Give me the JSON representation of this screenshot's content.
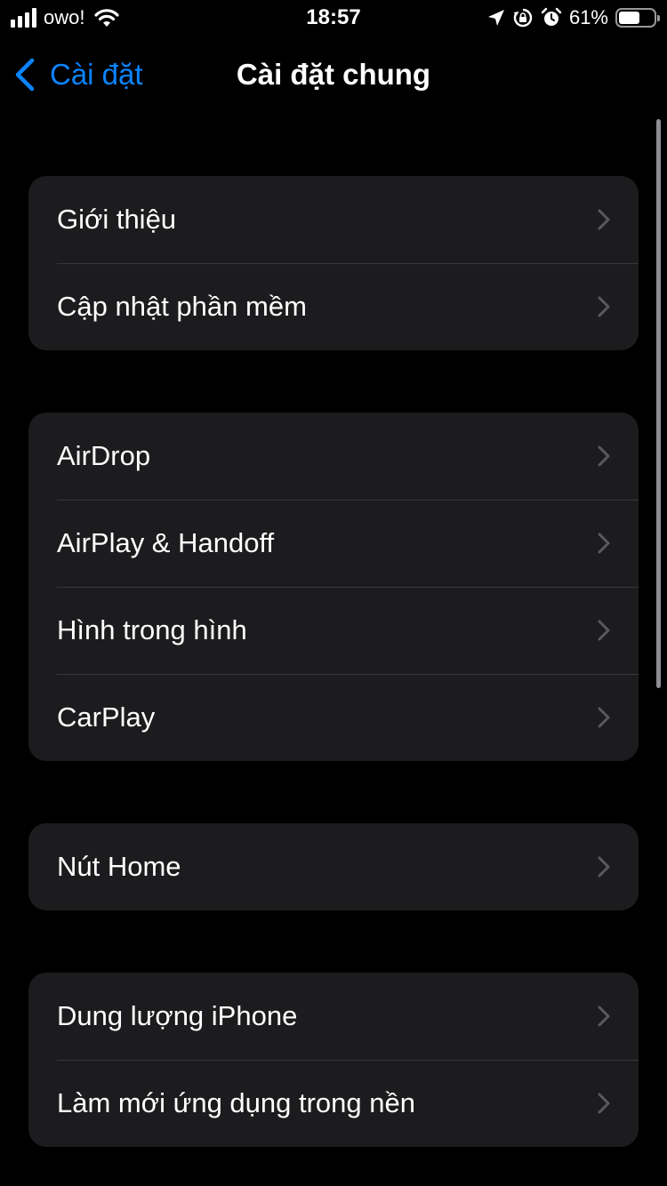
{
  "status_bar": {
    "carrier": "owo!",
    "time": "18:57",
    "battery_percent": "61%",
    "battery_level": 0.61,
    "icons": [
      "signal-icon",
      "wifi-icon",
      "location-icon",
      "orientation-lock-icon",
      "alarm-icon",
      "battery-icon"
    ]
  },
  "nav": {
    "back_label": "Cài đặt",
    "title": "Cài đặt chung"
  },
  "groups": [
    {
      "rows": [
        {
          "label": "Giới thiệu"
        },
        {
          "label": "Cập nhật phần mềm"
        }
      ]
    },
    {
      "rows": [
        {
          "label": "AirDrop"
        },
        {
          "label": "AirPlay & Handoff"
        },
        {
          "label": "Hình trong hình"
        },
        {
          "label": "CarPlay"
        }
      ]
    },
    {
      "rows": [
        {
          "label": "Nút Home"
        }
      ]
    },
    {
      "rows": [
        {
          "label": "Dung lượng iPhone"
        },
        {
          "label": "Làm mới ứng dụng trong nền"
        }
      ]
    }
  ],
  "colors": {
    "background": "#000000",
    "cell": "#1c1c1e",
    "separator": "#38383a",
    "accent": "#0a84ff",
    "chevron": "#5a5a5e"
  }
}
